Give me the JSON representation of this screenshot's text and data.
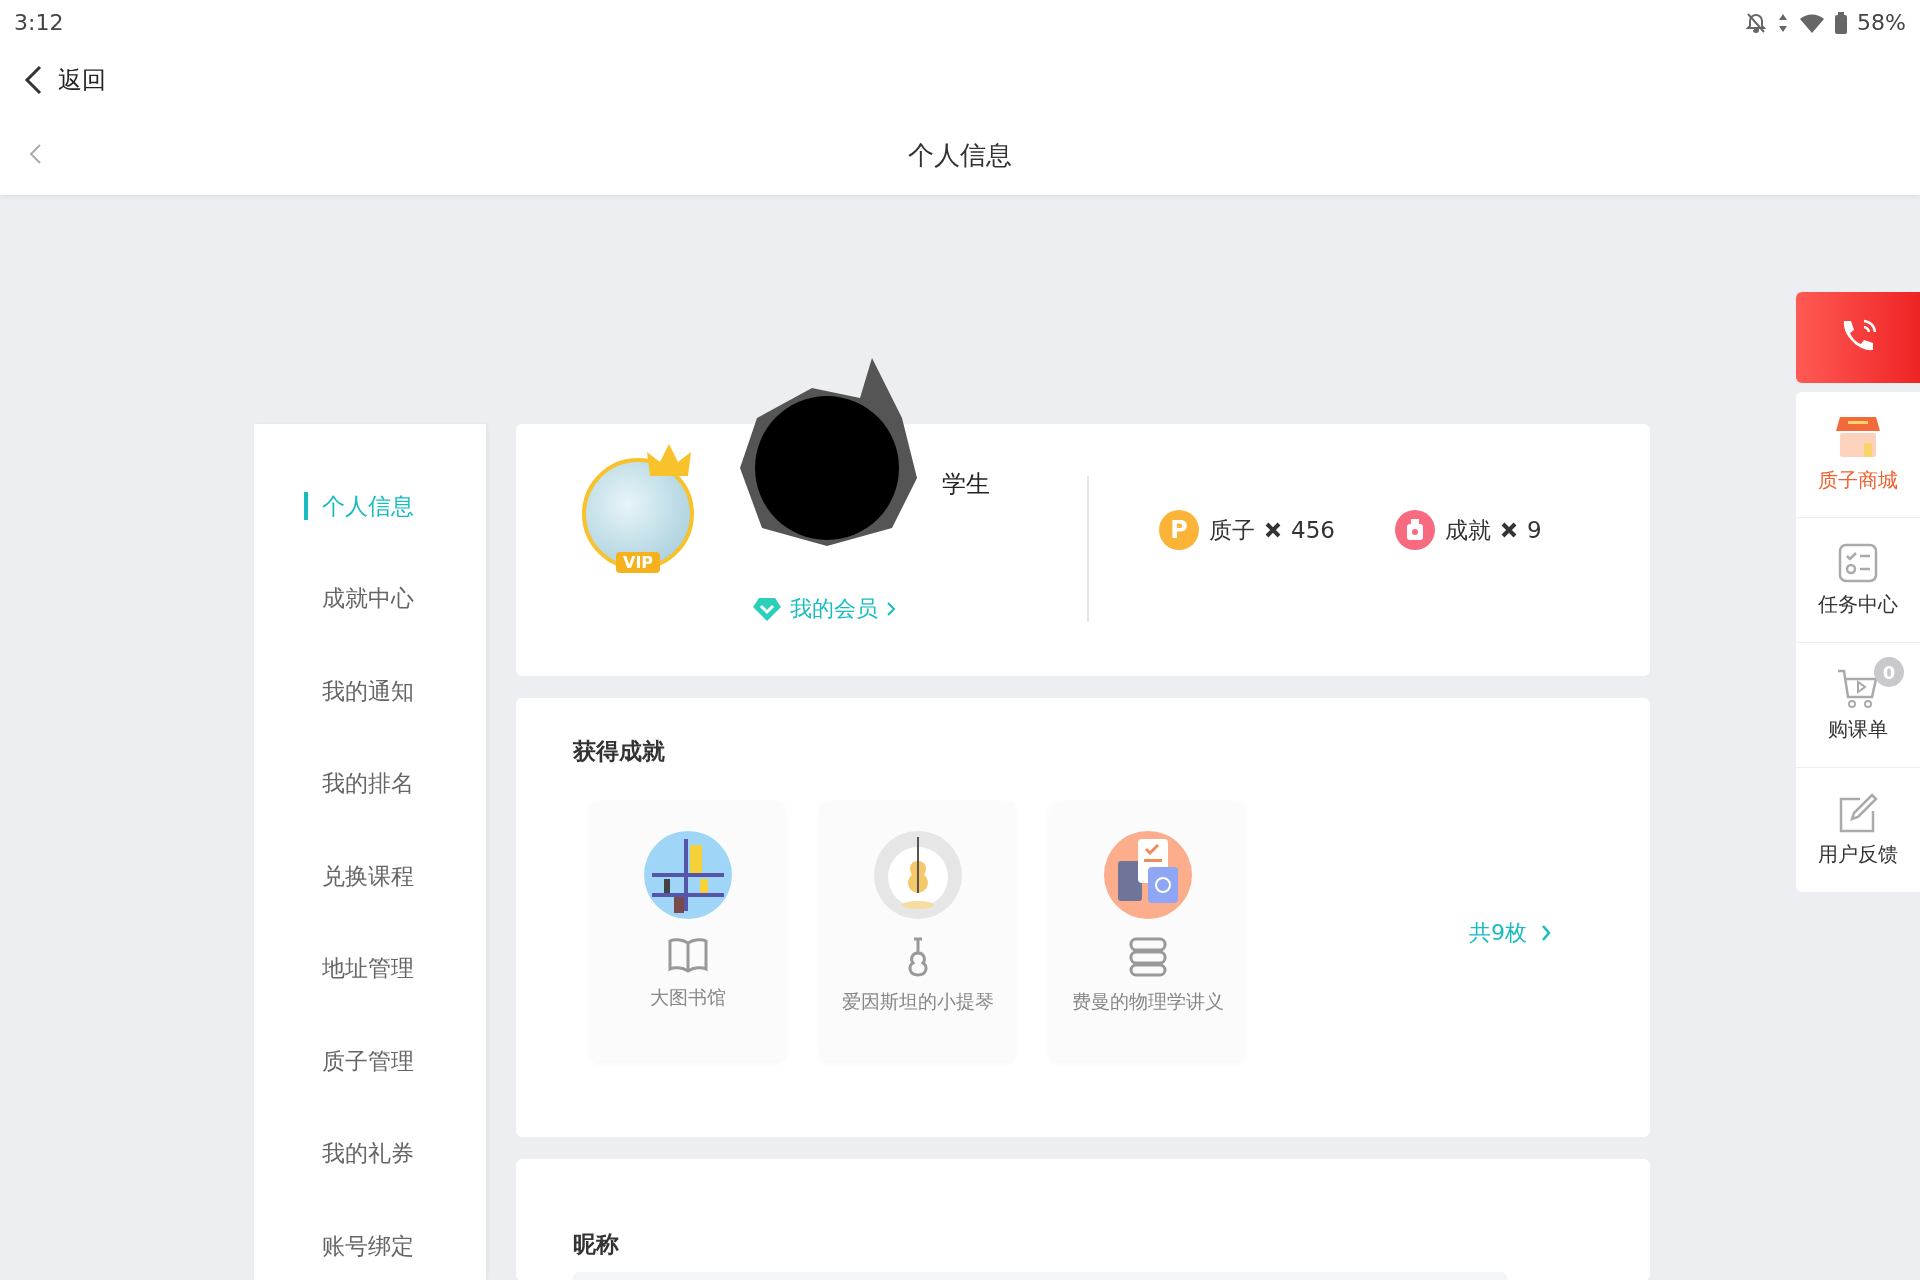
{
  "status_bar": {
    "time": "3:12",
    "battery": "58%"
  },
  "nav": {
    "back_label": "返回"
  },
  "header": {
    "title": "个人信息"
  },
  "sidebar": {
    "items": [
      {
        "label": "个人信息",
        "selected": true
      },
      {
        "label": "成就中心",
        "selected": false
      },
      {
        "label": "我的通知",
        "selected": false
      },
      {
        "label": "我的排名",
        "selected": false
      },
      {
        "label": "兑换课程",
        "selected": false
      },
      {
        "label": "地址管理",
        "selected": false
      },
      {
        "label": "质子管理",
        "selected": false
      },
      {
        "label": "我的礼券",
        "selected": false
      },
      {
        "label": "账号绑定",
        "selected": false
      }
    ]
  },
  "profile": {
    "role": "学生",
    "member_link": "我的会员",
    "badge": "VIP",
    "stats": [
      {
        "kind": "proton",
        "icon_letter": "P",
        "label": "质子",
        "count": "456"
      },
      {
        "kind": "achievement",
        "label": "成就",
        "count": "9"
      }
    ]
  },
  "achievements": {
    "title": "获得成就",
    "items": [
      {
        "kind": "library",
        "label": "大图书馆"
      },
      {
        "kind": "violin",
        "label": "爱因斯坦的小提琴"
      },
      {
        "kind": "lectures",
        "label": "费曼的物理学讲义"
      }
    ],
    "more_link": "共9枚"
  },
  "nickname": {
    "label": "昵称"
  },
  "float_menu": {
    "items": [
      {
        "kind": "shop",
        "label": "质子商城",
        "selected": true
      },
      {
        "kind": "tasks",
        "label": "任务中心",
        "selected": false
      },
      {
        "kind": "cart",
        "label": "购课单",
        "selected": false,
        "badge": "0"
      },
      {
        "kind": "feedback",
        "label": "用户反馈",
        "selected": false
      }
    ]
  }
}
